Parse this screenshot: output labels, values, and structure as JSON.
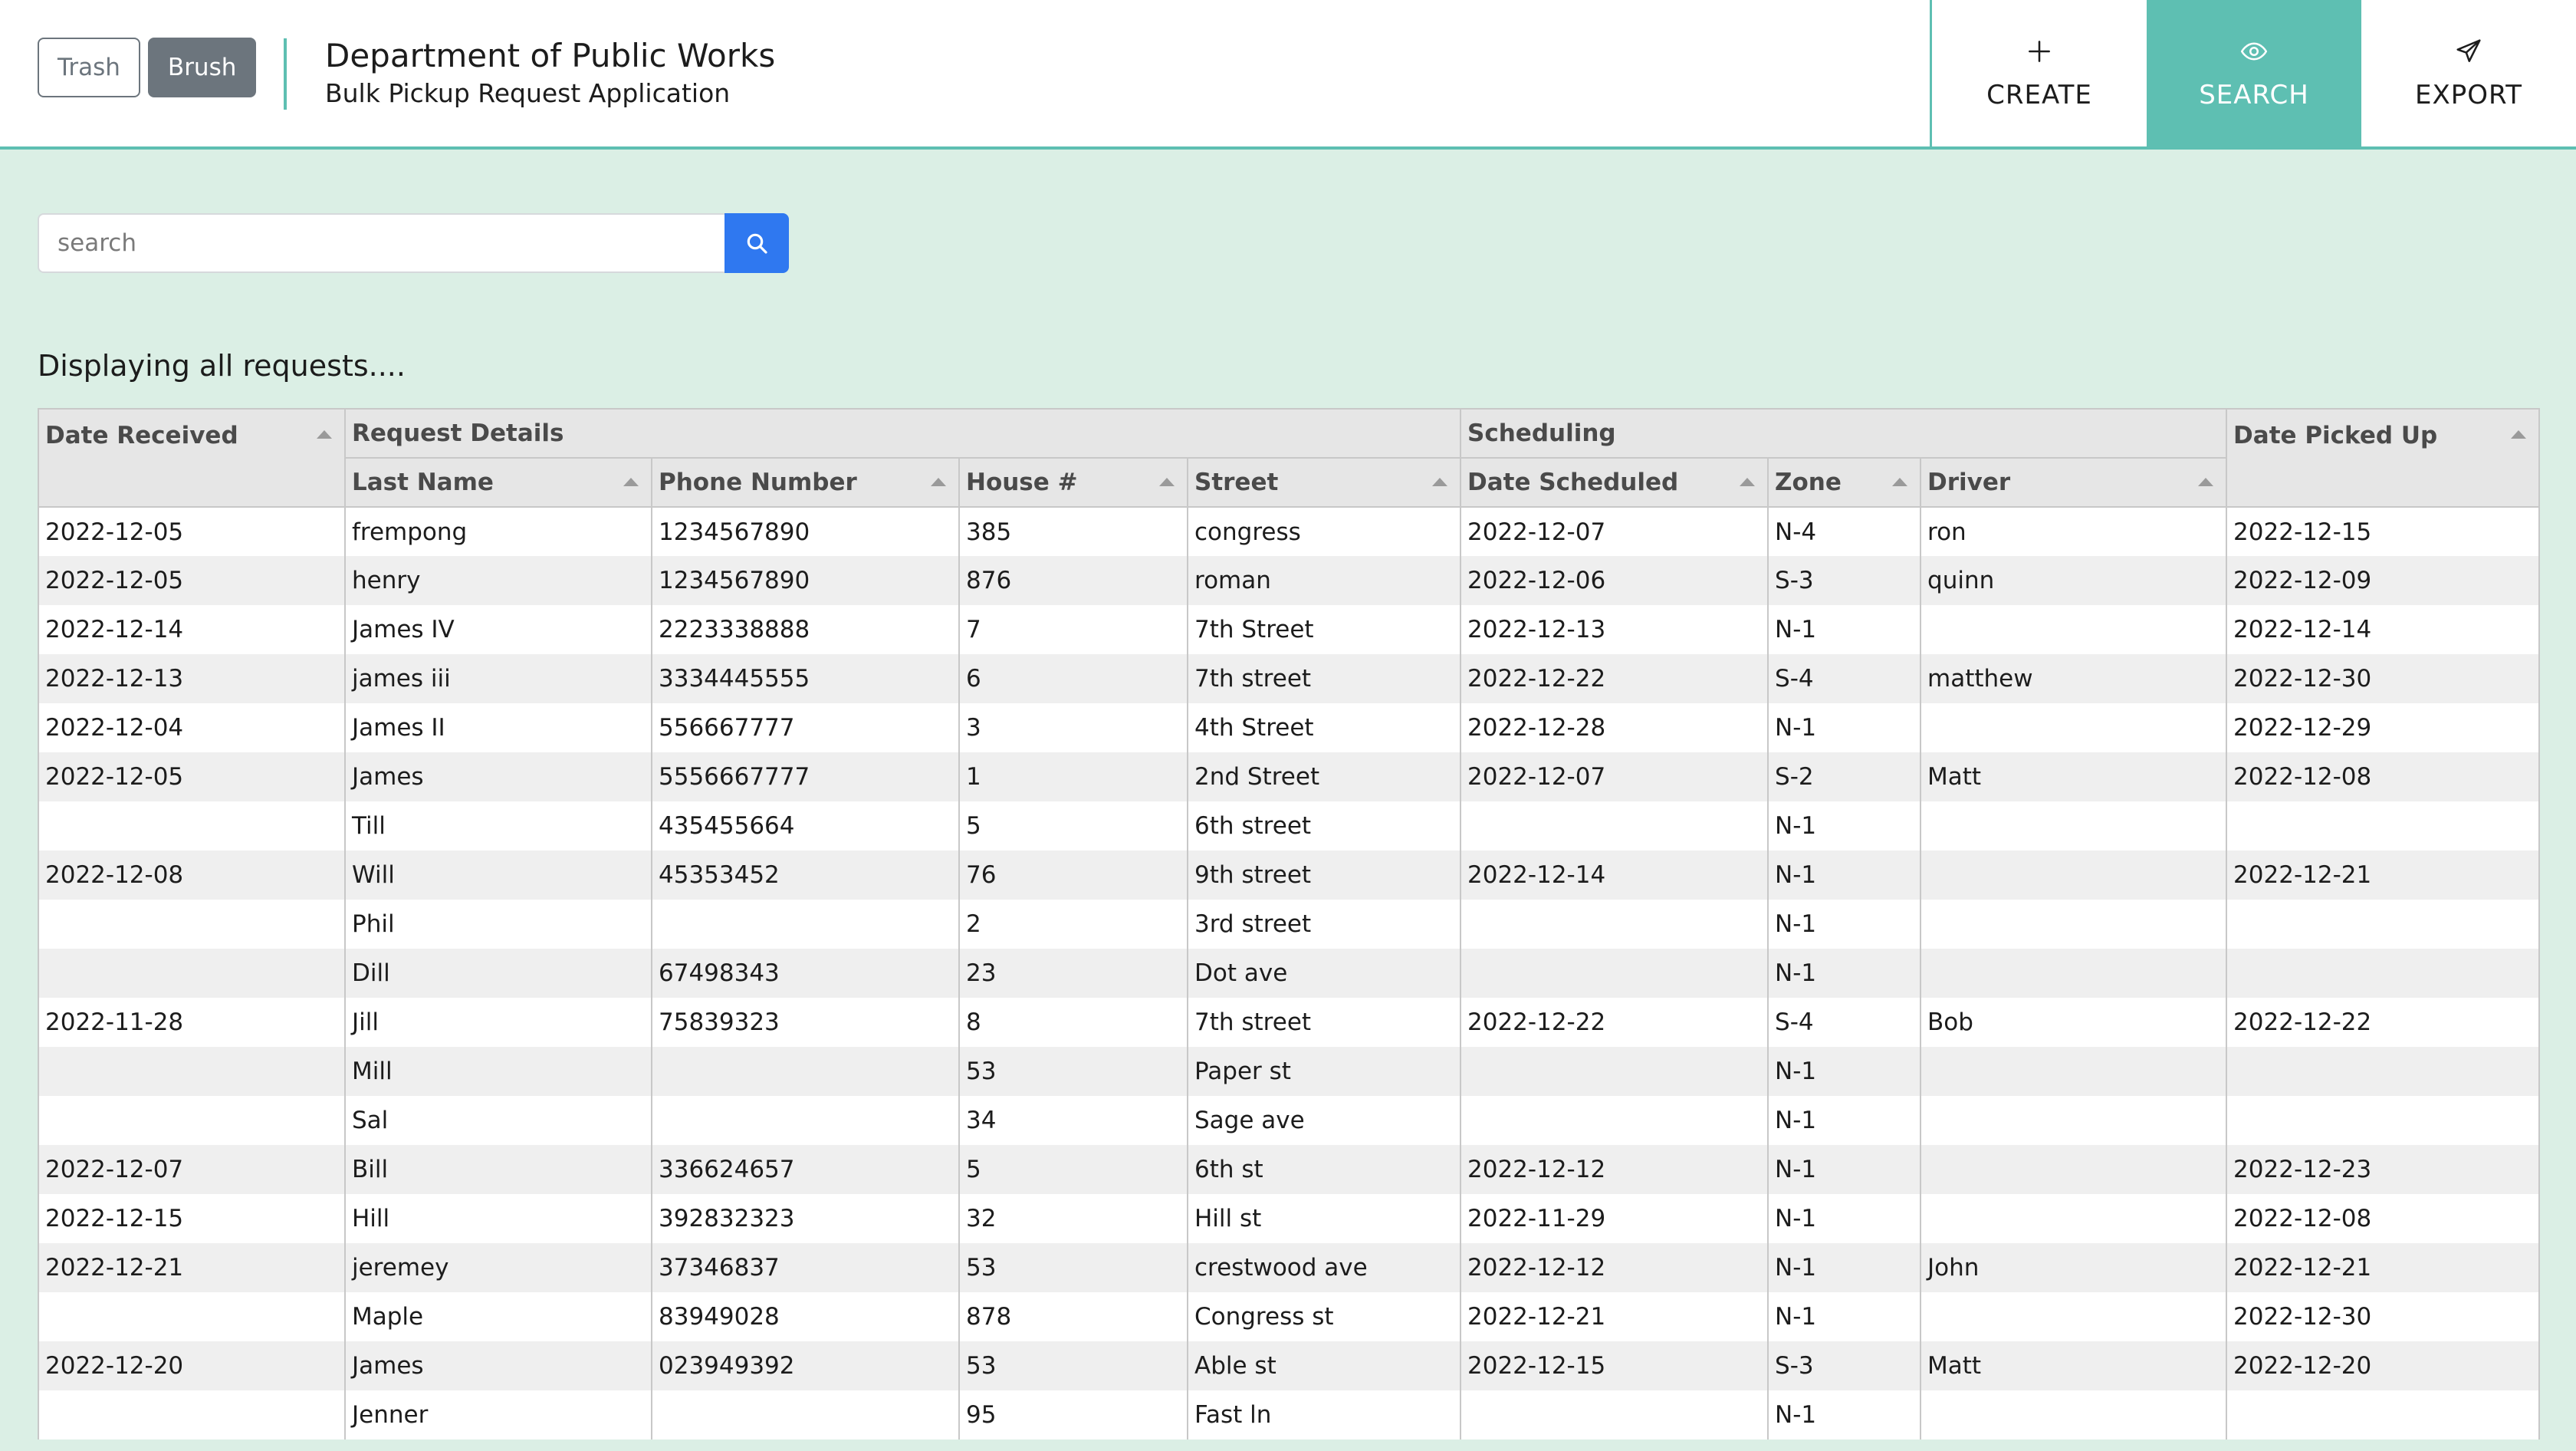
{
  "header": {
    "toggles": [
      {
        "label": "Trash",
        "active": false
      },
      {
        "label": "Brush",
        "active": true
      }
    ],
    "title": "Department of Public Works",
    "subtitle": "Bulk Pickup Request Application",
    "nav": [
      {
        "label": "CREATE",
        "icon": "plus-icon",
        "active": false
      },
      {
        "label": "SEARCH",
        "icon": "eye-icon",
        "active": true
      },
      {
        "label": "EXPORT",
        "icon": "send-icon",
        "active": false
      }
    ]
  },
  "search": {
    "placeholder": "search",
    "value": "",
    "button_icon": "search-icon"
  },
  "display_heading": "Displaying all requests....",
  "table": {
    "group_headers": {
      "date_received": "Date Received",
      "request_details": "Request Details",
      "scheduling": "Scheduling",
      "date_picked_up": "Date Picked Up"
    },
    "columns": {
      "last_name": "Last Name",
      "phone_number": "Phone Number",
      "house": "House #",
      "street": "Street",
      "date_scheduled": "Date Scheduled",
      "zone": "Zone",
      "driver": "Driver"
    },
    "rows": [
      {
        "date_received": "2022-12-05",
        "last_name": "frempong",
        "phone": "1234567890",
        "house": "385",
        "street": "congress",
        "date_scheduled": "2022-12-07",
        "zone": "N-4",
        "driver": "ron",
        "date_picked_up": "2022-12-15"
      },
      {
        "date_received": "2022-12-05",
        "last_name": "henry",
        "phone": "1234567890",
        "house": "876",
        "street": "roman",
        "date_scheduled": "2022-12-06",
        "zone": "S-3",
        "driver": "quinn",
        "date_picked_up": "2022-12-09"
      },
      {
        "date_received": "2022-12-14",
        "last_name": "James IV",
        "phone": "2223338888",
        "house": "7",
        "street": "7th Street",
        "date_scheduled": "2022-12-13",
        "zone": "N-1",
        "driver": "",
        "date_picked_up": "2022-12-14"
      },
      {
        "date_received": "2022-12-13",
        "last_name": "james iii",
        "phone": "3334445555",
        "house": "6",
        "street": "7th street",
        "date_scheduled": "2022-12-22",
        "zone": "S-4",
        "driver": "matthew",
        "date_picked_up": "2022-12-30"
      },
      {
        "date_received": "2022-12-04",
        "last_name": "James II",
        "phone": "556667777",
        "house": "3",
        "street": "4th Street",
        "date_scheduled": "2022-12-28",
        "zone": "N-1",
        "driver": "",
        "date_picked_up": "2022-12-29"
      },
      {
        "date_received": "2022-12-05",
        "last_name": "James",
        "phone": "5556667777",
        "house": "1",
        "street": "2nd Street",
        "date_scheduled": "2022-12-07",
        "zone": "S-2",
        "driver": "Matt",
        "date_picked_up": "2022-12-08"
      },
      {
        "date_received": "",
        "last_name": "Till",
        "phone": "435455664",
        "house": "5",
        "street": "6th street",
        "date_scheduled": "",
        "zone": "N-1",
        "driver": "",
        "date_picked_up": ""
      },
      {
        "date_received": "2022-12-08",
        "last_name": "Will",
        "phone": "45353452",
        "house": "76",
        "street": "9th street",
        "date_scheduled": "2022-12-14",
        "zone": "N-1",
        "driver": "",
        "date_picked_up": "2022-12-21"
      },
      {
        "date_received": "",
        "last_name": "Phil",
        "phone": "",
        "house": "2",
        "street": "3rd street",
        "date_scheduled": "",
        "zone": "N-1",
        "driver": "",
        "date_picked_up": ""
      },
      {
        "date_received": "",
        "last_name": "Dill",
        "phone": "67498343",
        "house": "23",
        "street": "Dot ave",
        "date_scheduled": "",
        "zone": "N-1",
        "driver": "",
        "date_picked_up": ""
      },
      {
        "date_received": "2022-11-28",
        "last_name": "Jill",
        "phone": "75839323",
        "house": "8",
        "street": "7th street",
        "date_scheduled": "2022-12-22",
        "zone": "S-4",
        "driver": "Bob",
        "date_picked_up": "2022-12-22"
      },
      {
        "date_received": "",
        "last_name": "Mill",
        "phone": "",
        "house": "53",
        "street": "Paper st",
        "date_scheduled": "",
        "zone": "N-1",
        "driver": "",
        "date_picked_up": ""
      },
      {
        "date_received": "",
        "last_name": "Sal",
        "phone": "",
        "house": "34",
        "street": "Sage ave",
        "date_scheduled": "",
        "zone": "N-1",
        "driver": "",
        "date_picked_up": ""
      },
      {
        "date_received": "2022-12-07",
        "last_name": "Bill",
        "phone": "336624657",
        "house": "5",
        "street": "6th st",
        "date_scheduled": "2022-12-12",
        "zone": "N-1",
        "driver": "",
        "date_picked_up": "2022-12-23"
      },
      {
        "date_received": "2022-12-15",
        "last_name": "Hill",
        "phone": "392832323",
        "house": "32",
        "street": "Hill st",
        "date_scheduled": "2022-11-29",
        "zone": "N-1",
        "driver": "",
        "date_picked_up": "2022-12-08"
      },
      {
        "date_received": "2022-12-21",
        "last_name": "jeremey",
        "phone": "37346837",
        "house": "53",
        "street": "crestwood ave",
        "date_scheduled": "2022-12-12",
        "zone": "N-1",
        "driver": "John",
        "date_picked_up": "2022-12-21"
      },
      {
        "date_received": "",
        "last_name": "Maple",
        "phone": "83949028",
        "house": "878",
        "street": "Congress st",
        "date_scheduled": "2022-12-21",
        "zone": "N-1",
        "driver": "",
        "date_picked_up": "2022-12-30"
      },
      {
        "date_received": "2022-12-20",
        "last_name": "James",
        "phone": "023949392",
        "house": "53",
        "street": "Able st",
        "date_scheduled": "2022-12-15",
        "zone": "S-3",
        "driver": "Matt",
        "date_picked_up": "2022-12-20"
      },
      {
        "date_received": "",
        "last_name": "Jenner",
        "phone": "",
        "house": "95",
        "street": "Fast ln",
        "date_scheduled": "",
        "zone": "N-1",
        "driver": "",
        "date_picked_up": ""
      }
    ]
  },
  "colors": {
    "accent": "#5ebfb2",
    "page_background": "#dbefe5",
    "search_button": "#2f78f0",
    "toggle_active": "#6c757d"
  }
}
